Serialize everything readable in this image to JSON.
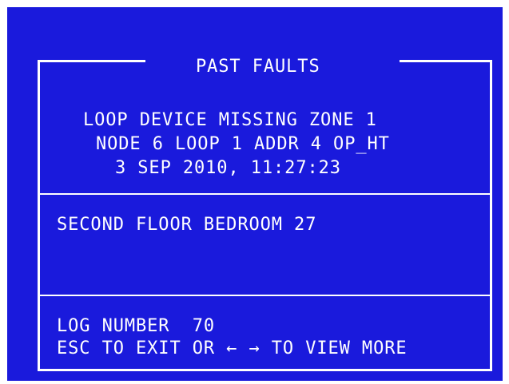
{
  "panel": {
    "title": "PAST FAULTS",
    "fault": {
      "line1": "LOOP DEVICE MISSING ZONE 1",
      "line2": "NODE 6 LOOP 1 ADDR 4 OP_HT",
      "line3": "3 SEP 2010, 11:27:23"
    },
    "location": "SECOND FLOOR BEDROOM 27",
    "log_number": "LOG NUMBER  70",
    "help": "ESC TO EXIT OR ← → TO VIEW MORE"
  },
  "colors": {
    "background": "#1a1adc",
    "foreground": "#ffffff",
    "outer": "#ffffff"
  }
}
